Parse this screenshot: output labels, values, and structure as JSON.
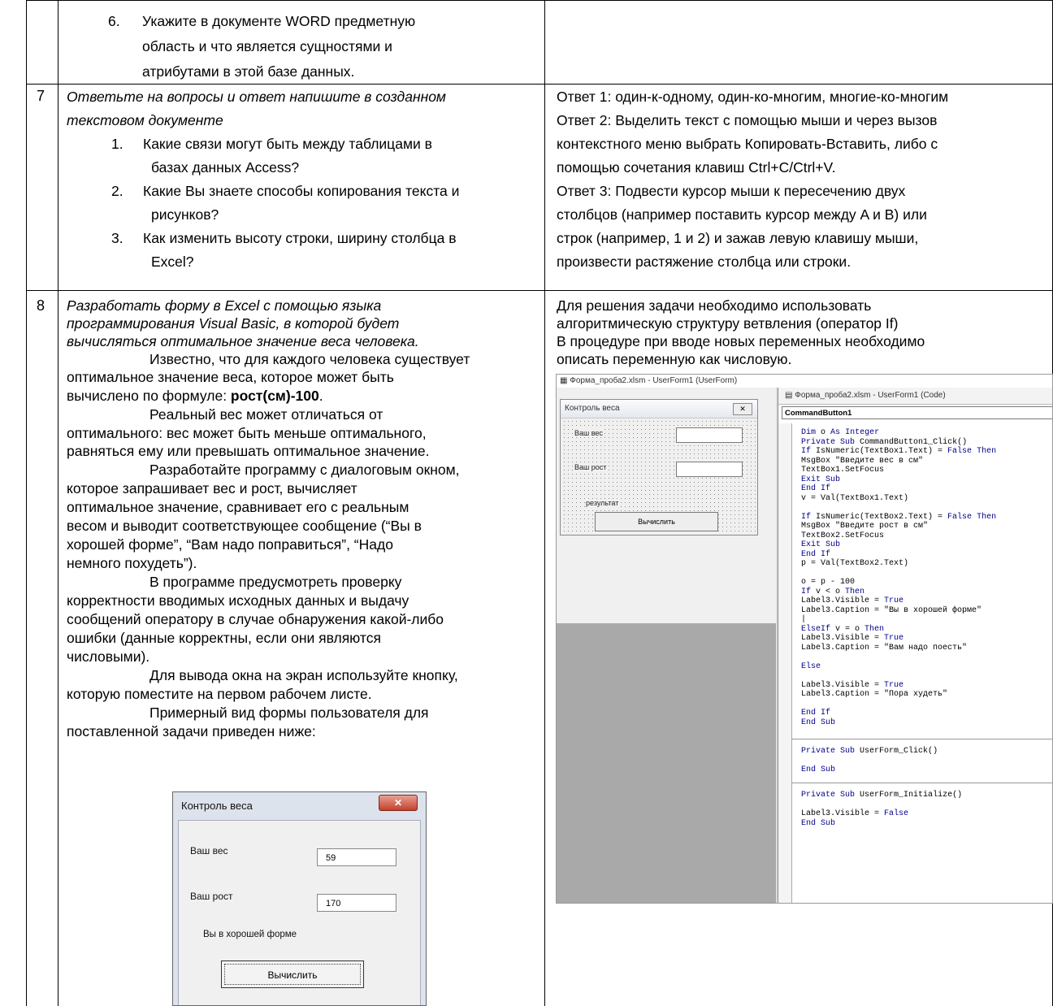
{
  "row6": {
    "item_number": "6.",
    "lines": [
      "Укажите в документе WORD предметную",
      "область и что является сущностями и",
      "атрибутами в этой базе данных."
    ]
  },
  "row7": {
    "number": "7",
    "intro_lines": [
      "Ответьте на вопросы и ответ напишите в созданном",
      "текстовом документе"
    ],
    "questions": [
      {
        "num": "1.",
        "lines": [
          "Какие связи могут быть между таблицами в",
          "базах данных Access?"
        ]
      },
      {
        "num": "2.",
        "lines": [
          "Какие Вы знаете способы копирования текста и",
          "рисунков?"
        ]
      },
      {
        "num": "3.",
        "lines": [
          "Как изменить высоту строки, ширину столбца в",
          "Excel?"
        ]
      }
    ],
    "answer_lines": [
      "Ответ 1: один-к-одному, один-ко-многим, многие-ко-многим",
      "Ответ 2: Выделить текст с помощью мыши и через вызов",
      "контекстного меню выбрать Копировать-Вставить, либо с",
      "помощью сочетания клавиш Ctrl+C/Ctrl+V.",
      "Ответ 3: Подвести курсор мыши к пересечению двух",
      "столбцов (например поставить курсор между A и B) или",
      "строк (например, 1 и 2) и зажав левую клавишу мыши,",
      "произвести растяжение столбца или строки."
    ]
  },
  "row8": {
    "number": "8",
    "task_italic_lines": [
      "Разработать форму в Excel с помощью языка",
      "программирования Visual Basic, в которой будет",
      "вычисляться оптимальное значение веса человека."
    ],
    "body_lines": [
      "Известно, что для каждого человека существует",
      "оптимальное значение веса, которое может быть",
      "вычислено по формуле: ",
      "Реальный вес может отличаться от",
      "оптимального: вес может быть меньше оптимального,",
      "равняться ему или превышать оптимальное значение.",
      "Разработайте программу с диалоговым окном,",
      "которое запрашивает вес и рост, вычисляет",
      "оптимальное значение, сравнивает его с реальным",
      "весом и выводит соответствующее сообщение (“Вы в",
      "хорошей форме”, “Вам надо поправиться”, “Надо",
      "немного похудеть”).",
      "В программе предусмотреть проверку",
      "корректности вводимых исходных данных и выдачу",
      "сообщений оператору в случае обнаружения какой-либо",
      "ошибки (данные корректны, если они являются",
      "числовыми).",
      "Для вывода окна на экран используйте кнопку,",
      "которую поместите на первом рабочем листе.",
      "Примерный вид формы пользователя для",
      "поставленной задачи приведен ниже:"
    ],
    "formula_bold": "рост(см)-100",
    "formula_tail": ".",
    "answer_lines": [
      "Для решения задачи необходимо использовать",
      "алгоритмическую структуру ветвления (оператор If)",
      "В процедуре при вводе новых переменных необходимо",
      "описать переменную как числовую."
    ]
  },
  "vba_screenshot": {
    "designer_title": "Форма_проба2.xlsm - UserForm1 (UserForm)",
    "form_caption": "Контроль веса",
    "close_glyph": "✕",
    "label_weight": "Ваш вес",
    "label_height": "Ваш рост",
    "label_result": "результат",
    "button_label": "Вычислить",
    "code_title": "Форма_проба2.xlsm - UserForm1 (Code)",
    "object_combo": "CommandButton1",
    "code_block1": "Dim o As Integer\nPrivate Sub CommandButton1_Click()\nIf IsNumeric(TextBox1.Text) = False Then\nMsgBox \"Введите вес в см\"\nTextBox1.SetFocus\nExit Sub\nEnd If\nv = Val(TextBox1.Text)\n\nIf IsNumeric(TextBox2.Text) = False Then\nMsgBox \"Введите рост в см\"\nTextBox2.SetFocus\nExit Sub\nEnd If\np = Val(TextBox2.Text)\n\no = p - 100\nIf v < o Then\nLabel3.Visible = True\nLabel3.Caption = \"Вы в хорошей форме\"\n|\nElseIf v = o Then\nLabel3.Visible = True\nLabel3.Caption = \"Вам надо поесть\"\n\nElse\n\nLabel3.Visible = True\nLabel3.Caption = \"Пора худеть\"\n\nEnd If\nEnd Sub",
    "code_block2": "Private Sub UserForm_Click()\n\nEnd Sub",
    "code_block3": "Private Sub UserForm_Initialize()\n\nLabel3.Visible = False\nEnd Sub"
  },
  "sample_dialog": {
    "title": "Контроль веса",
    "close_glyph": "✕",
    "label_weight": "Ваш вес",
    "value_weight": "59",
    "label_height": "Ваш рост",
    "value_height": "170",
    "result_text": "Вы в хорошей форме",
    "button_label": "Вычислить"
  }
}
